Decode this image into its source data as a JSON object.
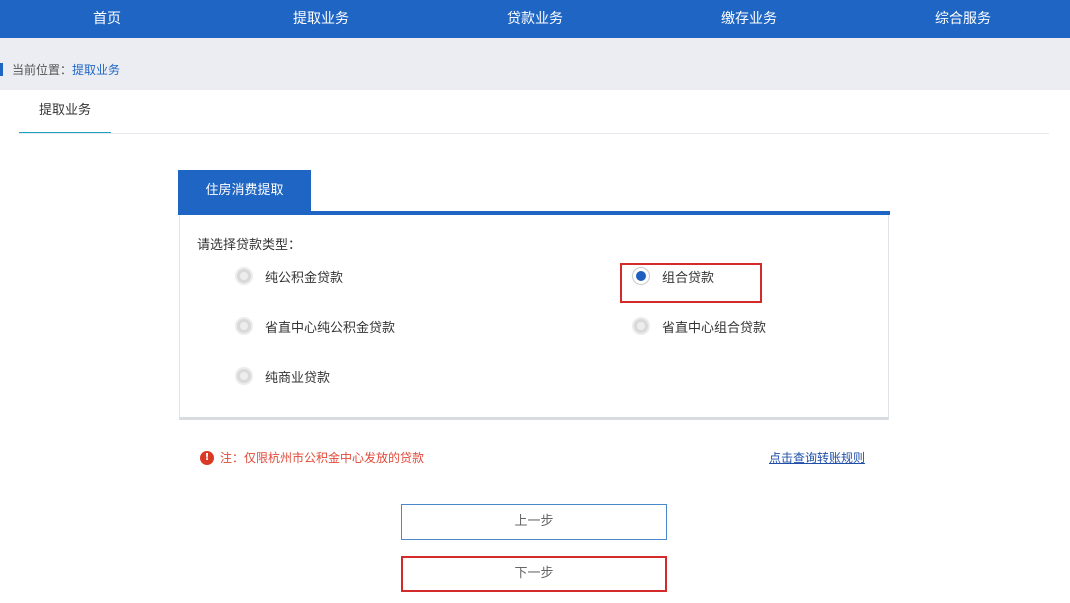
{
  "nav": {
    "items": [
      {
        "label": "首页"
      },
      {
        "label": "提取业务"
      },
      {
        "label": "贷款业务"
      },
      {
        "label": "缴存业务"
      },
      {
        "label": "综合服务"
      }
    ]
  },
  "breadcrumb": {
    "prefix": "当前位置：",
    "current": "提取业务"
  },
  "page_tab": {
    "label": "提取业务"
  },
  "card": {
    "tab_label": "住房消费提取",
    "prompt": "请选择贷款类型：",
    "options": [
      {
        "label": "纯公积金贷款",
        "selected": false
      },
      {
        "label": "组合贷款",
        "selected": true
      },
      {
        "label": "省直中心纯公积金贷款",
        "selected": false
      },
      {
        "label": "省直中心组合贷款",
        "selected": false
      },
      {
        "label": "纯商业贷款",
        "selected": false
      }
    ]
  },
  "note": {
    "icon": "warning-icon",
    "icon_glyph": "!",
    "text": "注：仅限杭州市公积金中心发放的贷款"
  },
  "rules_link": {
    "label": "点击查询转账规则"
  },
  "buttons": {
    "prev_label": "上一步",
    "next_label": "下一步"
  },
  "colors": {
    "primary": "#1f66c4",
    "highlight": "#d42a2a",
    "note_text": "#e04a3a"
  }
}
